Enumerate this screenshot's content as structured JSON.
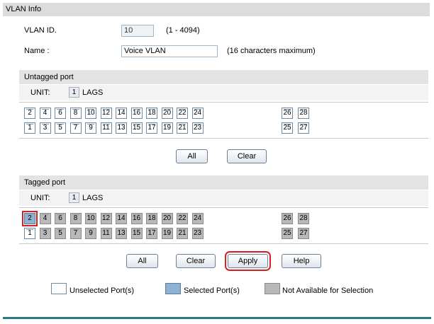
{
  "section_title": "VLAN Info",
  "vlan_id": {
    "label": "VLAN ID.",
    "value": "10",
    "hint": "(1 - 4094)"
  },
  "name": {
    "label": "Name :",
    "value": "Voice VLAN",
    "hint": "(16 characters maximum)"
  },
  "untagged": {
    "title": "Untagged port",
    "unit_label": "UNIT:",
    "unit_value": "1",
    "lags_label": "LAGS",
    "buttons": {
      "all": "All",
      "clear": "Clear"
    },
    "top_row": [
      "2",
      "4",
      "6",
      "8",
      "10",
      "12",
      "14",
      "16",
      "18",
      "20",
      "22",
      "24",
      "26",
      "28"
    ],
    "bottom_row": [
      "1",
      "3",
      "5",
      "7",
      "9",
      "11",
      "13",
      "15",
      "17",
      "19",
      "21",
      "23",
      "25",
      "27"
    ]
  },
  "tagged": {
    "title": "Tagged port",
    "unit_label": "UNIT:",
    "unit_value": "1",
    "lags_label": "LAGS",
    "buttons": {
      "all": "All",
      "clear": "Clear",
      "apply": "Apply",
      "help": "Help"
    },
    "top_row": [
      "2",
      "4",
      "6",
      "8",
      "10",
      "12",
      "14",
      "16",
      "18",
      "20",
      "22",
      "24",
      "26",
      "28"
    ],
    "bottom_row": [
      "1",
      "3",
      "5",
      "7",
      "9",
      "11",
      "13",
      "15",
      "17",
      "19",
      "21",
      "23",
      "25",
      "27"
    ],
    "selected_ports": [
      "2"
    ],
    "unselected_ports": [
      "1"
    ]
  },
  "legend": {
    "unselected": "Unselected Port(s)",
    "selected": "Selected Port(s)",
    "not_available": "Not Available for Selection"
  },
  "colors": {
    "selected": "#8fb2d2",
    "not_available": "#b9b9b9",
    "highlight": "#d42020",
    "rule": "#2a7a86"
  }
}
